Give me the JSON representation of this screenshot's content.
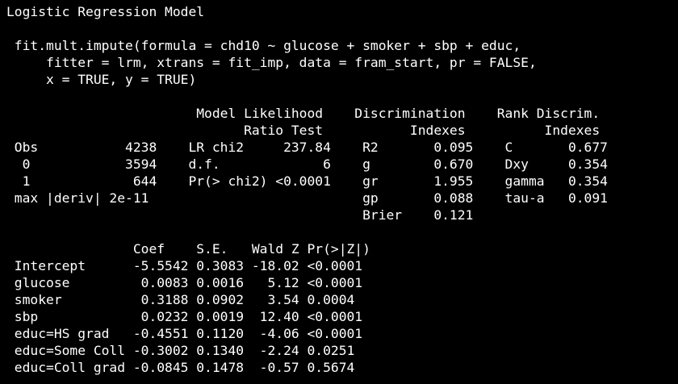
{
  "console": {
    "background": "#000000",
    "text_color": "#ffffff",
    "lines": [
      "Logistic Regression Model",
      "",
      " fit.mult.impute(formula = chd10 ~ glucose + smoker + sbp + educ,",
      "     fitter = lrm, xtrans = fit_imp, data = fram_start, pr = FALSE,",
      "     x = TRUE, y = TRUE)",
      "",
      "                        Model Likelihood    Discrimination    Rank Discrim.",
      "                              Ratio Test           Indexes          Indexes",
      " Obs           4238    LR chi2     237.84    R2       0.095    C       0.677",
      "  0            3594    d.f.             6    g        0.670    Dxy     0.354",
      "  1             644    Pr(> chi2) <0.0001    gr       1.955    gamma   0.354",
      " max |deriv| 2e-11                           gp       0.088    tau-a   0.091",
      "                                             Brier    0.121",
      "",
      "                Coef    S.E.   Wald Z Pr(>|Z|)",
      " Intercept      -5.5542 0.3083 -18.02 <0.0001",
      " glucose         0.0083 0.0016   5.12 <0.0001",
      " smoker          0.3188 0.0902   3.54 0.0004",
      " sbp             0.0232 0.0019  12.40 <0.0001",
      " educ=HS grad   -0.4551 0.1120  -4.06 <0.0001",
      " educ=Some Coll -0.3002 0.1340  -2.24 0.0251",
      " educ=Coll grad -0.0845 0.1478  -0.57 0.5674"
    ]
  }
}
